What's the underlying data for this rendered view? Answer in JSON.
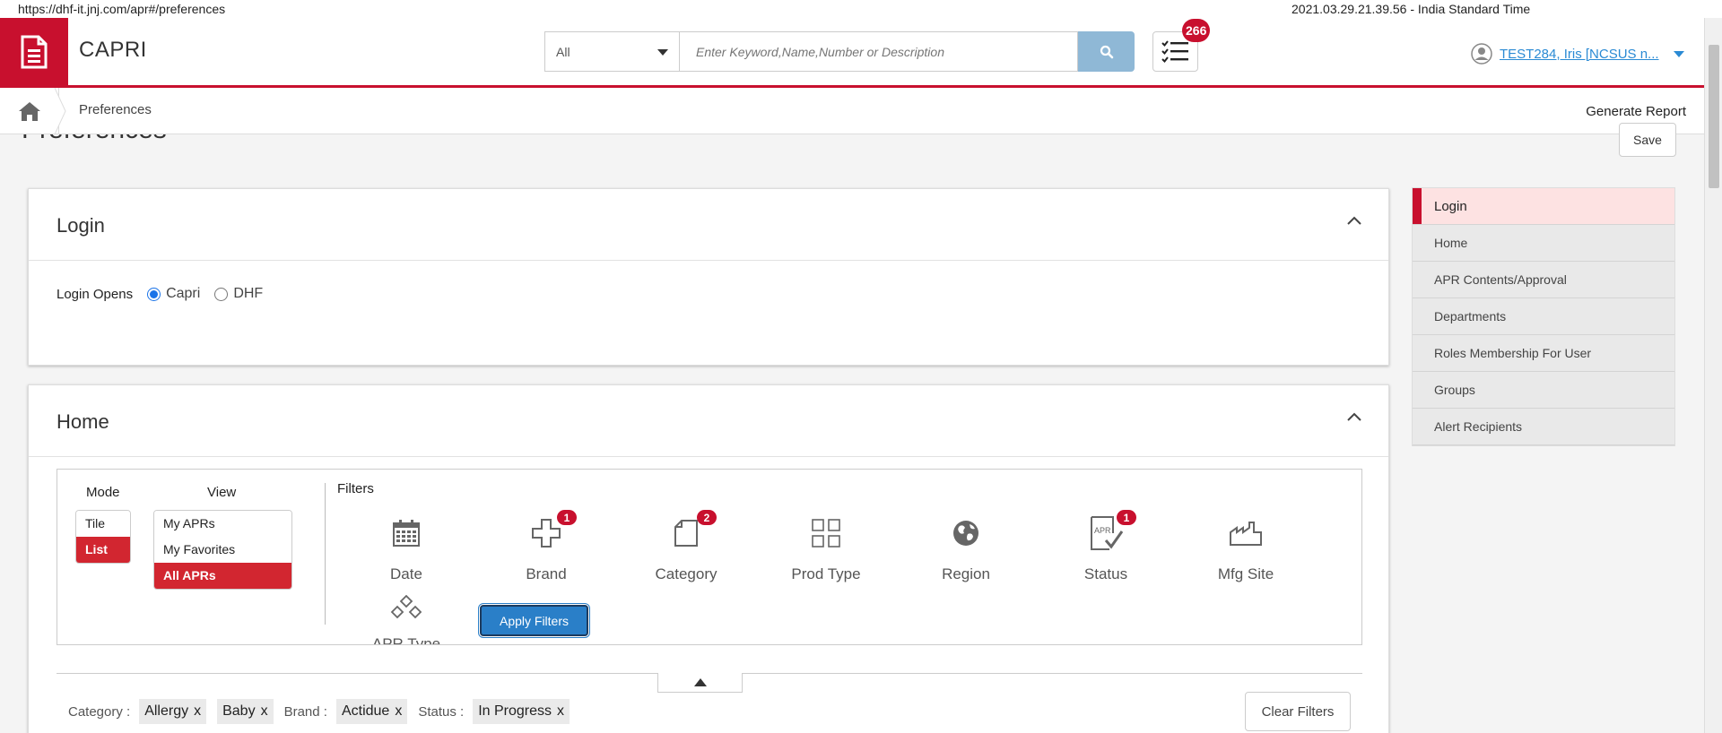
{
  "browser": {
    "url": "https://dhf-it.jnj.com/apr#/preferences",
    "timestamp": "2021.03.29.21.39.56 - India Standard Time"
  },
  "header": {
    "app_name": "CAPRI",
    "search_scope": "All",
    "search_placeholder": "Enter Keyword,Name,Number or Description",
    "tasks_count": "266",
    "user_name": "TEST284, Iris [NCSUS n..."
  },
  "breadcrumb": {
    "current": "Preferences",
    "generate_report": "Generate Report"
  },
  "page": {
    "title": "Preferences",
    "save_label": "Save"
  },
  "login_panel": {
    "title": "Login",
    "login_opens_label": "Login Opens",
    "options": [
      "Capri",
      "DHF"
    ],
    "selected": "Capri"
  },
  "home_panel": {
    "title": "Home",
    "mode_label": "Mode",
    "view_label": "View",
    "modes": [
      "Tile",
      "List"
    ],
    "selected_mode": "List",
    "views": [
      "My APRs",
      "My Favorites",
      "All APRs"
    ],
    "selected_view": "All APRs",
    "filters_label": "Filters",
    "filters": [
      {
        "label": "Date",
        "icon": "calendar-icon",
        "badge": ""
      },
      {
        "label": "Brand",
        "icon": "plus-outline-icon",
        "badge": "1"
      },
      {
        "label": "Category",
        "icon": "document-icon",
        "badge": "2"
      },
      {
        "label": "Prod Type",
        "icon": "grid-icon",
        "badge": ""
      },
      {
        "label": "Region",
        "icon": "globe-icon",
        "badge": ""
      },
      {
        "label": "Status",
        "icon": "apr-check-icon",
        "badge": "1"
      },
      {
        "label": "Mfg Site",
        "icon": "factory-icon",
        "badge": ""
      },
      {
        "label": "APR Type",
        "icon": "diamonds-icon",
        "badge": ""
      }
    ],
    "apply_filters": "Apply Filters",
    "active_filters": {
      "category_label": "Category :",
      "category_values": [
        "Allergy",
        "Baby"
      ],
      "brand_label": "Brand :",
      "brand_values": [
        "Actidue"
      ],
      "status_label": "Status :",
      "status_values": [
        "In Progress"
      ]
    },
    "clear_filters": "Clear Filters"
  },
  "right_nav": {
    "items": [
      "Login",
      "Home",
      "APR Contents/Approval",
      "Departments",
      "Roles Membership For User",
      "Groups",
      "Alert Recipients"
    ],
    "active": "Login"
  },
  "colors": {
    "brand_red": "#c8102e",
    "selected_red": "#d22630",
    "link_blue": "#2a8ad4",
    "apply_blue": "#2a7fc8",
    "search_button": "#8fb8d6"
  }
}
